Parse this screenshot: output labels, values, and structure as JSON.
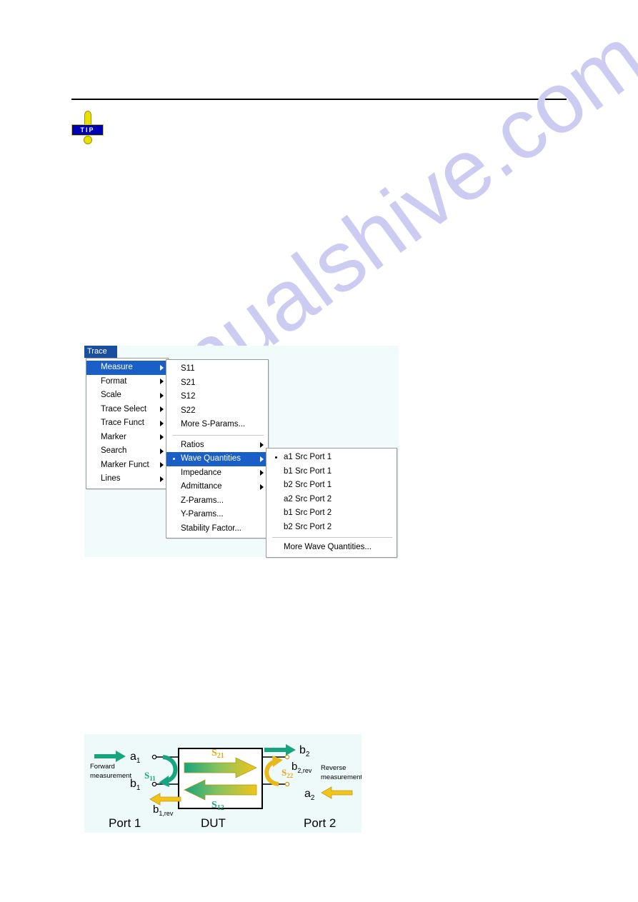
{
  "page": {
    "background": "#ffffff",
    "rule_color": "#000000",
    "watermark_text": "manualshive.com",
    "watermark_color": "#ccccf2"
  },
  "tip_icon": {
    "label": "TIP",
    "banner_color": "#0000b4",
    "mark_color": "#e8e000"
  },
  "menu": {
    "root_label": "Trace",
    "root_color": "#1a4fa0",
    "highlight_color": "#1a5fc8",
    "level1": [
      {
        "label": "Measure",
        "submenu": true,
        "selected": true,
        "bullet": false
      },
      {
        "label": "Format",
        "submenu": true,
        "selected": false,
        "bullet": false
      },
      {
        "label": "Scale",
        "submenu": true,
        "selected": false,
        "bullet": false
      },
      {
        "label": "Trace Select",
        "submenu": true,
        "selected": false,
        "bullet": false
      },
      {
        "label": "Trace Funct",
        "submenu": true,
        "selected": false,
        "bullet": false
      },
      {
        "label": "Marker",
        "submenu": true,
        "selected": false,
        "bullet": false
      },
      {
        "label": "Search",
        "submenu": true,
        "selected": false,
        "bullet": false
      },
      {
        "label": "Marker Funct",
        "submenu": true,
        "selected": false,
        "bullet": false
      },
      {
        "label": "Lines",
        "submenu": true,
        "selected": false,
        "bullet": false
      }
    ],
    "level2": [
      {
        "label": "S11",
        "submenu": false,
        "selected": false,
        "bullet": false,
        "separator_after": false
      },
      {
        "label": "S21",
        "submenu": false,
        "selected": false,
        "bullet": false,
        "separator_after": false
      },
      {
        "label": "S12",
        "submenu": false,
        "selected": false,
        "bullet": false,
        "separator_after": false
      },
      {
        "label": "S22",
        "submenu": false,
        "selected": false,
        "bullet": false,
        "separator_after": false
      },
      {
        "label": "More S-Params...",
        "submenu": false,
        "selected": false,
        "bullet": false,
        "separator_after": true
      },
      {
        "label": "Ratios",
        "submenu": true,
        "selected": false,
        "bullet": false,
        "separator_after": false
      },
      {
        "label": "Wave Quantities",
        "submenu": true,
        "selected": true,
        "bullet": true,
        "separator_after": false
      },
      {
        "label": "Impedance",
        "submenu": true,
        "selected": false,
        "bullet": false,
        "separator_after": false
      },
      {
        "label": "Admittance",
        "submenu": true,
        "selected": false,
        "bullet": false,
        "separator_after": false
      },
      {
        "label": "Z-Params...",
        "submenu": false,
        "selected": false,
        "bullet": false,
        "separator_after": false
      },
      {
        "label": "Y-Params...",
        "submenu": false,
        "selected": false,
        "bullet": false,
        "separator_after": false
      },
      {
        "label": "Stability Factor...",
        "submenu": false,
        "selected": false,
        "bullet": false,
        "separator_after": false
      }
    ],
    "level3": [
      {
        "label": "a1 Src Port 1",
        "submenu": false,
        "selected": false,
        "bullet": true,
        "separator_after": false
      },
      {
        "label": "b1 Src Port 1",
        "submenu": false,
        "selected": false,
        "bullet": false,
        "separator_after": false
      },
      {
        "label": "b2 Src Port 1",
        "submenu": false,
        "selected": false,
        "bullet": false,
        "separator_after": false
      },
      {
        "label": "a2 Src Port 2",
        "submenu": false,
        "selected": false,
        "bullet": false,
        "separator_after": false
      },
      {
        "label": "b1 Src Port 2",
        "submenu": false,
        "selected": false,
        "bullet": false,
        "separator_after": false
      },
      {
        "label": "b2 Src Port 2",
        "submenu": false,
        "selected": false,
        "bullet": false,
        "separator_after": true
      },
      {
        "label": "More Wave Quantities...",
        "submenu": false,
        "selected": false,
        "bullet": false,
        "separator_after": false
      }
    ]
  },
  "sparam_diagram": {
    "background": "#eef9fa",
    "green": "#17a57f",
    "gold": "#e8b91a",
    "dut_label": "DUT",
    "port1_label": "Port 1",
    "port2_label": "Port 2",
    "forward_line1": "Forward",
    "forward_line2": "measurement",
    "reverse_line1": "Reverse",
    "reverse_line2": "measurement",
    "wave_a1": "a",
    "wave_a1_sub": "1",
    "wave_b1": "b",
    "wave_b1_sub": "1",
    "wave_b2": "b",
    "wave_b2_sub": "2",
    "wave_a2": "a",
    "wave_a2_sub": "2",
    "wave_b1rev": "b",
    "wave_b1rev_sub": "1,rev",
    "wave_b2rev": "b",
    "wave_b2rev_sub": "2,rev",
    "s11": "S",
    "s11_sub": "11",
    "s21": "S",
    "s21_sub": "21",
    "s12": "S",
    "s12_sub": "12",
    "s22": "S",
    "s22_sub": "22"
  }
}
